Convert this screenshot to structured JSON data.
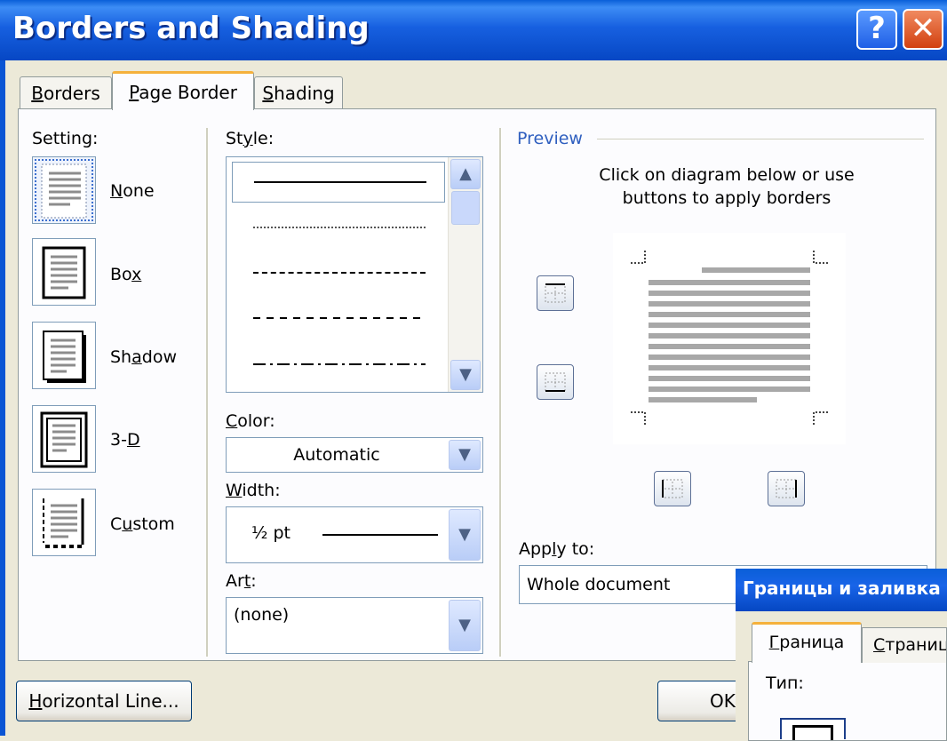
{
  "window": {
    "title": "Borders and Shading",
    "help_glyph": "?",
    "close_glyph": "✕"
  },
  "tabs": [
    {
      "pre": "",
      "key": "B",
      "post": "orders"
    },
    {
      "pre": "",
      "key": "P",
      "post": "age Border"
    },
    {
      "pre": "",
      "key": "S",
      "post": "hading"
    }
  ],
  "setting": {
    "label": "Setting:",
    "options": [
      {
        "pre": "",
        "key": "N",
        "post": "one",
        "icon": "setting-none-icon"
      },
      {
        "pre": "Bo",
        "key": "x",
        "post": "",
        "icon": "setting-box-icon"
      },
      {
        "pre": "Sh",
        "key": "a",
        "post": "dow",
        "icon": "setting-shadow-icon"
      },
      {
        "pre": "3-",
        "key": "D",
        "post": "",
        "icon": "setting-3d-icon"
      },
      {
        "pre": "C",
        "key": "u",
        "post": "stom",
        "icon": "setting-custom-icon"
      }
    ]
  },
  "style": {
    "pre": "St",
    "key": "y",
    "post": "le:"
  },
  "color": {
    "pre": "",
    "key": "C",
    "post": "olor:",
    "value": "Automatic"
  },
  "width": {
    "pre": "",
    "key": "W",
    "post": "idth:",
    "value": "½ pt"
  },
  "art": {
    "pre": "Ar",
    "key": "t",
    "post": ":",
    "value": "(none)"
  },
  "preview": {
    "label": "Preview",
    "instructions_line1": "Click on diagram below or use",
    "instructions_line2": "buttons to apply borders"
  },
  "apply_to": {
    "pre": "App",
    "key": "l",
    "post": "y to:",
    "value": "Whole document"
  },
  "buttons": {
    "horizontal_pre": "",
    "horizontal_key": "H",
    "horizontal_post": "orizontal Line...",
    "ok": "OK"
  },
  "overlay_dialog": {
    "title": "Границы и заливка",
    "tab1_pre": "",
    "tab1_key": "Г",
    "tab1_post": "раница",
    "tab2_pre": "",
    "tab2_key": "С",
    "tab2_post": "траниц",
    "type_label": "Тип:"
  },
  "colors": {
    "title_blue": "#0a5fd8",
    "face": "#ece9d8",
    "accent_tab": "#f5b13c",
    "preview_label": "#2f5fbf"
  }
}
